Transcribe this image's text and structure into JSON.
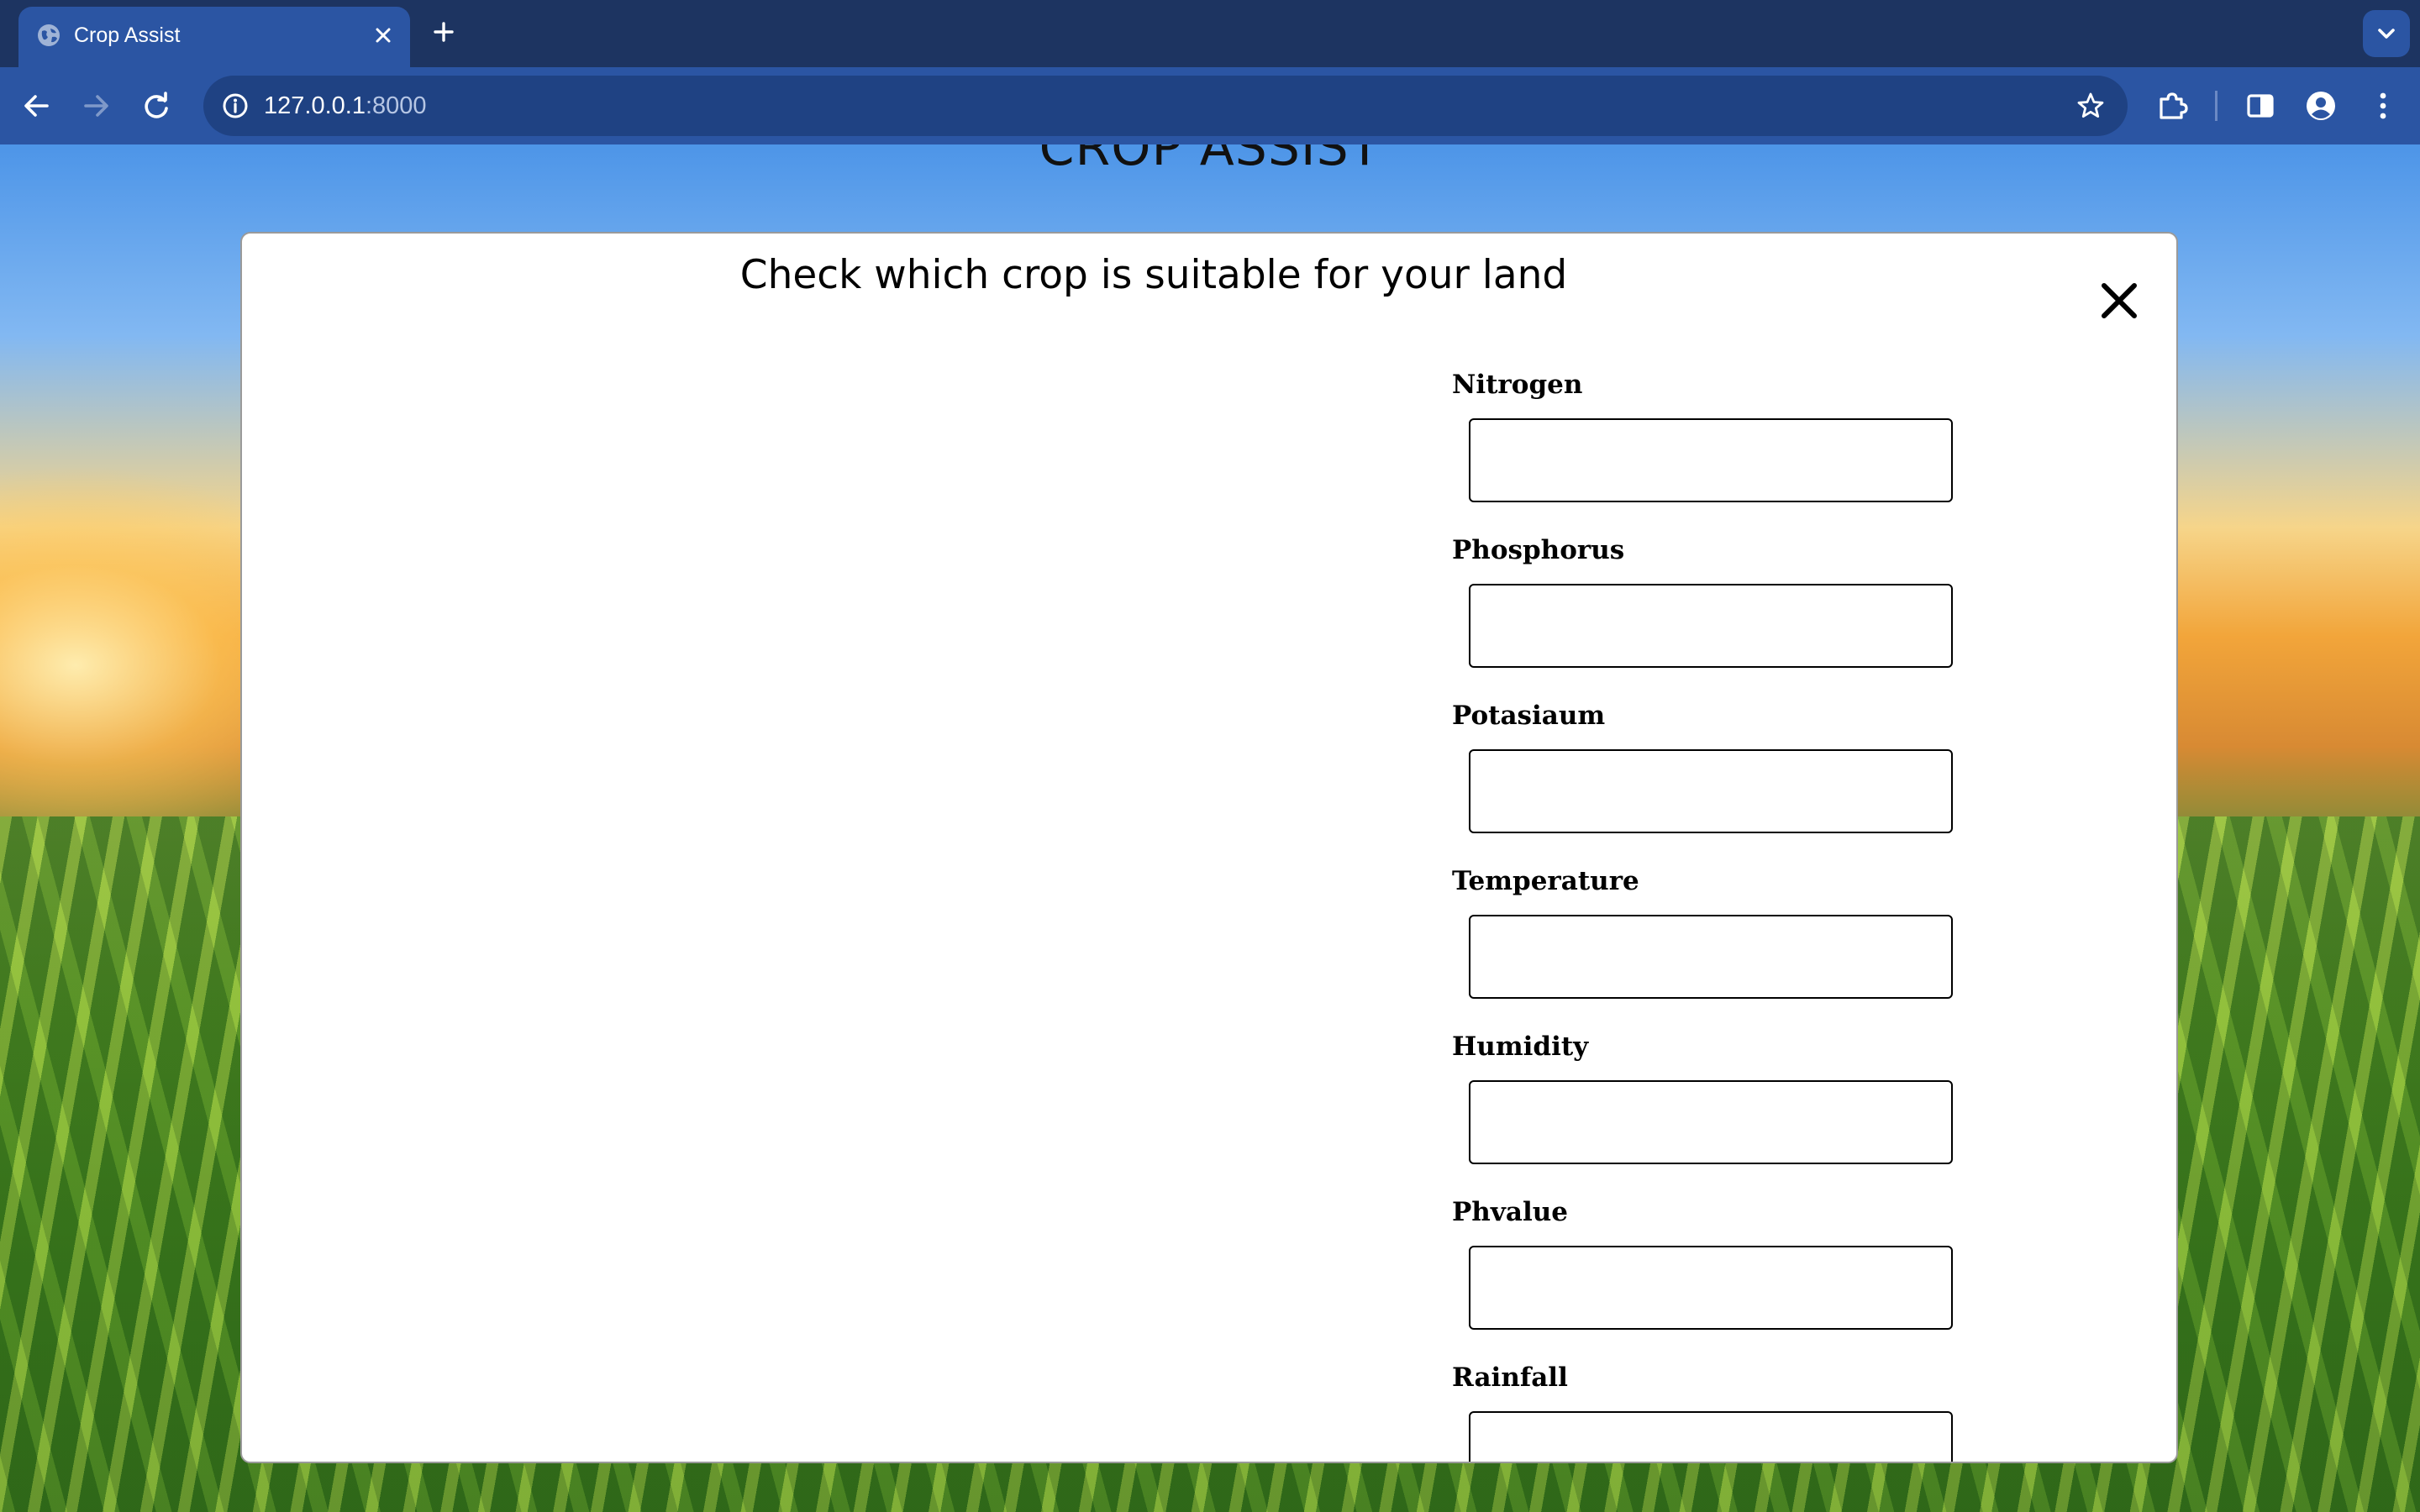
{
  "browser": {
    "tab_title": "Crop Assist",
    "url_host": "127.0.0.1",
    "url_port": ":8000",
    "colors": {
      "tabstrip": "#1d3461",
      "toolbar": "#2b55a3",
      "omnibox": "#1f4283"
    }
  },
  "page": {
    "site_title": "CROP ASSIST",
    "modal": {
      "heading": "Check which crop is suitable for your land",
      "close_symbol": "✕",
      "fields": [
        {
          "label": "Nitrogen",
          "value": ""
        },
        {
          "label": "Phosphorus",
          "value": ""
        },
        {
          "label": "Potasiaum",
          "value": ""
        },
        {
          "label": "Temperature",
          "value": ""
        },
        {
          "label": "Humidity",
          "value": ""
        },
        {
          "label": "Phvalue",
          "value": ""
        },
        {
          "label": "Rainfall",
          "value": ""
        }
      ]
    }
  }
}
